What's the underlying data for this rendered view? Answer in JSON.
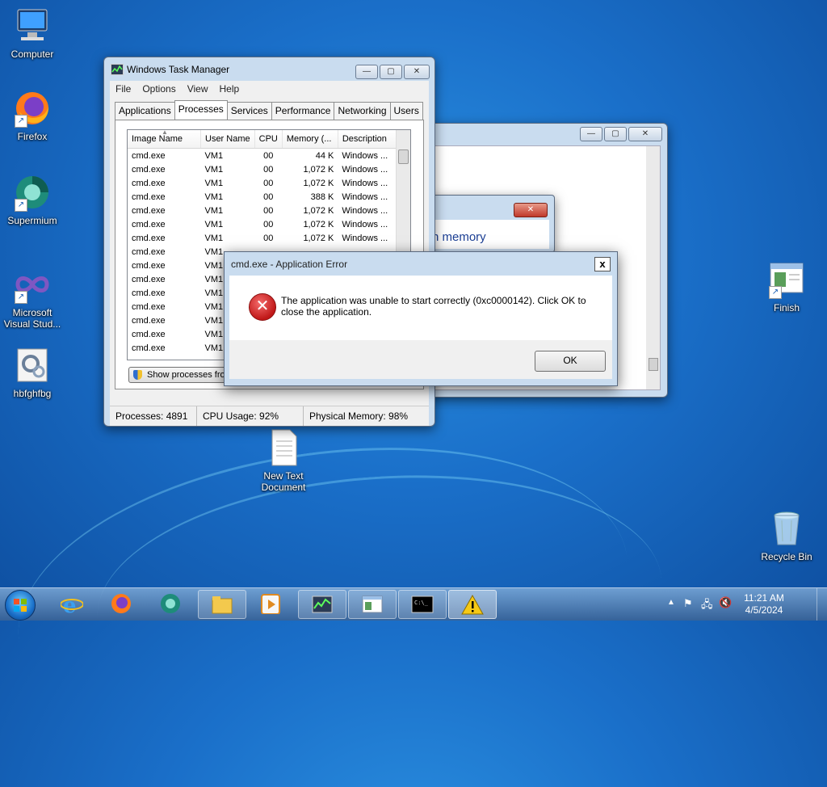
{
  "desktop": {
    "icons": [
      {
        "label": "Computer"
      },
      {
        "label": "Firefox"
      },
      {
        "label": "Supermium"
      },
      {
        "label": "Microsoft Visual Stud..."
      },
      {
        "label": "hbfghfbg"
      },
      {
        "label": "New Text Document"
      },
      {
        "label": "Finish"
      },
      {
        "label": "Recycle Bin"
      }
    ]
  },
  "task_manager": {
    "title": "Windows Task Manager",
    "menu": [
      "File",
      "Options",
      "View",
      "Help"
    ],
    "tabs": [
      "Applications",
      "Processes",
      "Services",
      "Performance",
      "Networking",
      "Users"
    ],
    "active_tab": "Processes",
    "columns": [
      "Image Name",
      "User Name",
      "CPU",
      "Memory (...",
      "Description"
    ],
    "rows": [
      [
        "cmd.exe",
        "VM1",
        "00",
        "44 K",
        "Windows ..."
      ],
      [
        "cmd.exe",
        "VM1",
        "00",
        "1,072 K",
        "Windows ..."
      ],
      [
        "cmd.exe",
        "VM1",
        "00",
        "1,072 K",
        "Windows ..."
      ],
      [
        "cmd.exe",
        "VM1",
        "00",
        "388 K",
        "Windows ..."
      ],
      [
        "cmd.exe",
        "VM1",
        "00",
        "1,072 K",
        "Windows ..."
      ],
      [
        "cmd.exe",
        "VM1",
        "00",
        "1,072 K",
        "Windows ..."
      ],
      [
        "cmd.exe",
        "VM1",
        "00",
        "1,072 K",
        "Windows ..."
      ],
      [
        "cmd.exe",
        "VM1",
        "",
        "",
        ""
      ],
      [
        "cmd.exe",
        "VM1",
        "",
        "",
        ""
      ],
      [
        "cmd.exe",
        "VM1",
        "",
        "",
        ""
      ],
      [
        "cmd.exe",
        "VM1",
        "",
        "",
        ""
      ],
      [
        "cmd.exe",
        "VM1",
        "",
        "",
        ""
      ],
      [
        "cmd.exe",
        "VM1",
        "",
        "",
        ""
      ],
      [
        "cmd.exe",
        "VM1",
        "",
        "",
        ""
      ],
      [
        "cmd.exe",
        "VM1",
        "",
        "",
        ""
      ]
    ],
    "show_processes_label": "Show processes fro",
    "status": {
      "processes": "Processes: 4891",
      "cpu": "CPU Usage: 92%",
      "memory": "Physical Memory: 98%"
    }
  },
  "background_dialog": {
    "text_fragment": "n memory"
  },
  "error_dialog": {
    "title": "cmd.exe - Application Error",
    "close_label": "x",
    "message": "The application was unable to start correctly (0xc0000142). Click OK to close the application.",
    "ok_label": "OK"
  },
  "taskbar": {
    "clock_time": "11:21 AM",
    "clock_date": "4/5/2024"
  }
}
